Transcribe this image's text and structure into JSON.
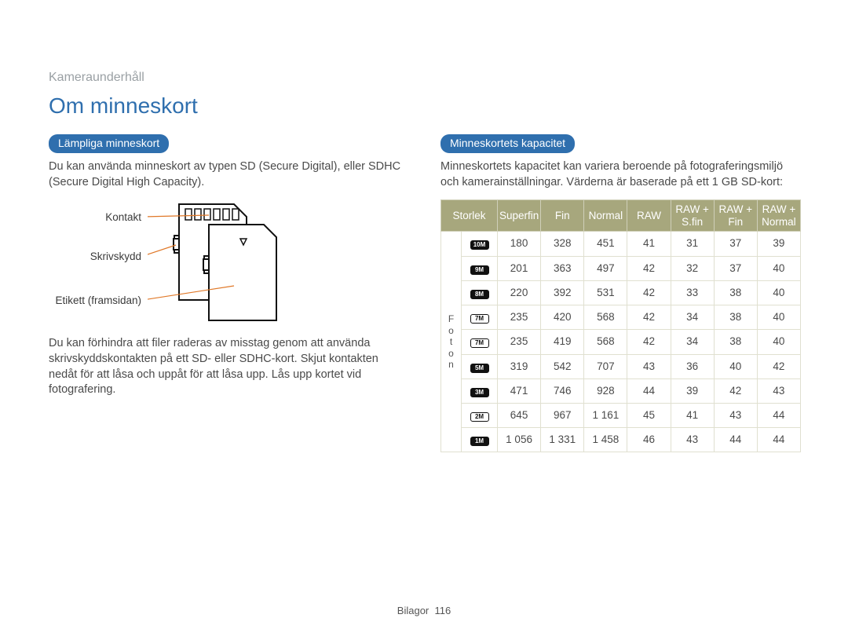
{
  "breadcrumb": "Kameraunderhåll",
  "title": "Om minneskort",
  "left": {
    "heading_pill": "Lämpliga minneskort",
    "intro": "Du kan använda minneskort av typen SD (Secure Digital), eller SDHC (Secure Digital High Capacity).",
    "labels": {
      "contact": "Kontakt",
      "write_protect": "Skrivskydd",
      "label_front": "Etikett (framsidan)"
    },
    "body2": "Du kan förhindra att filer raderas av misstag genom att använda skrivskyddskontakten på ett SD- eller SDHC-kort. Skjut kontakten nedåt för att låsa och uppåt för att låsa upp. Lås upp kortet vid fotografering."
  },
  "right": {
    "heading_pill": "Minneskortets kapacitet",
    "intro": "Minneskortets kapacitet kan variera beroende på fotograferingsmiljö och kamerainställningar. Värderna är baserade på ett 1 GB SD-kort:",
    "columns": [
      "Storlek",
      "Superfin",
      "Fin",
      "Normal",
      "RAW",
      "RAW +\nS.fin",
      "RAW +\nFin",
      "RAW +\nNormal"
    ],
    "row_group_label": [
      "F",
      "o",
      "t",
      "o",
      "n"
    ],
    "size_icons": [
      "10M",
      "9M",
      "8M",
      "7M",
      "7M",
      "5M",
      "3M",
      "2M",
      "1M"
    ],
    "size_icon_outline": {
      "3": true,
      "4": true,
      "7": true
    },
    "rows": [
      [
        "180",
        "328",
        "451",
        "41",
        "31",
        "37",
        "39"
      ],
      [
        "201",
        "363",
        "497",
        "42",
        "32",
        "37",
        "40"
      ],
      [
        "220",
        "392",
        "531",
        "42",
        "33",
        "38",
        "40"
      ],
      [
        "235",
        "420",
        "568",
        "42",
        "34",
        "38",
        "40"
      ],
      [
        "235",
        "419",
        "568",
        "42",
        "34",
        "38",
        "40"
      ],
      [
        "319",
        "542",
        "707",
        "43",
        "36",
        "40",
        "42"
      ],
      [
        "471",
        "746",
        "928",
        "44",
        "39",
        "42",
        "43"
      ],
      [
        "645",
        "967",
        "1 161",
        "45",
        "41",
        "43",
        "44"
      ],
      [
        "1 056",
        "1 331",
        "1 458",
        "46",
        "43",
        "44",
        "44"
      ]
    ]
  },
  "footer": {
    "section": "Bilagor",
    "page": "116"
  }
}
